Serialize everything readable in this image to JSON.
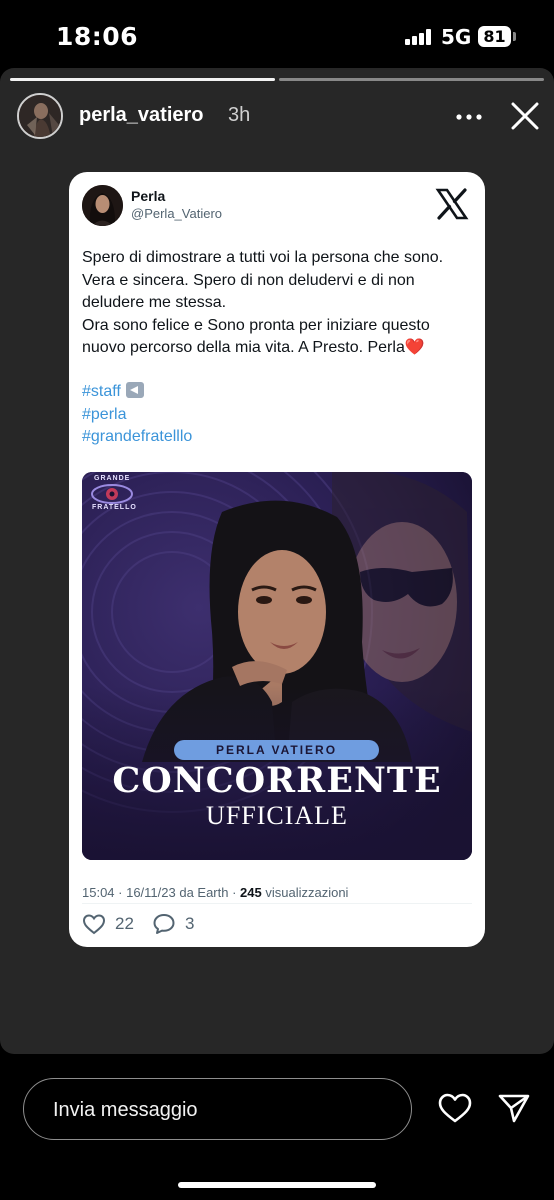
{
  "status_bar": {
    "time": "18:06",
    "network": "5G",
    "battery": "81"
  },
  "story": {
    "progress": {
      "segments": 2,
      "current": 1
    },
    "username": "perla_vatiero",
    "time_ago": "3h"
  },
  "tweet": {
    "name": "Perla",
    "handle": "@Perla_Vatiero",
    "paragraph1": "Spero di dimostrare a tutti voi la persona che sono. Vera e sincera. Spero di non deludervi e di non deludere me stessa.",
    "paragraph2": "Ora sono felice e Sono pronta per iniziare questo nuovo percorso della mia vita. A Presto. Perla",
    "heart_emoji": "❤️",
    "hashtags": [
      "#staff",
      "#perla",
      "#grandefratelllo"
    ],
    "image": {
      "logo_top": "GRANDE",
      "logo_bottom": "FRATELLO",
      "name_banner": "PERLA VATIERO",
      "headline": "CONCORRENTE",
      "subheadline": "UFFICIALE"
    },
    "meta": {
      "time": "15:04 · 16/11/23 da Earth · ",
      "views_count": "245",
      "views_label": " visualizzazioni"
    },
    "likes": "22",
    "replies": "3"
  },
  "bottom": {
    "message_placeholder": "Invia messaggio"
  },
  "colors": {
    "story_bg": "#272727",
    "hashtag": "#3b94d9",
    "image_bg": "#241a46",
    "banner": "#6f9de0"
  },
  "icons": [
    "signal-icon",
    "battery-icon",
    "more-options-icon",
    "close-icon",
    "x-logo-icon",
    "like-heart-icon",
    "reply-bubble-icon",
    "heart-icon",
    "send-icon"
  ]
}
